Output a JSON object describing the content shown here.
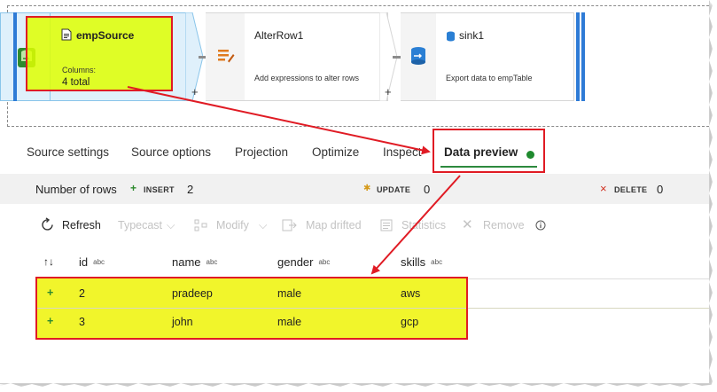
{
  "flow": {
    "source": {
      "title": "empSource",
      "columns_label": "Columns:",
      "columns_value": "4 total"
    },
    "alter": {
      "title": "AlterRow1",
      "description": "Add expressions to alter rows"
    },
    "sink": {
      "title": "sink1",
      "description": "Export data to empTable"
    },
    "plus": "+"
  },
  "tabs": [
    {
      "label": "Source settings"
    },
    {
      "label": "Source options"
    },
    {
      "label": "Projection"
    },
    {
      "label": "Optimize"
    },
    {
      "label": "Inspect"
    },
    {
      "label": "Data preview"
    }
  ],
  "rows_bar": {
    "number_label": "Number of rows",
    "insert_symbol": "+",
    "insert_label": "INSERT",
    "insert_count": "2",
    "update_symbol": "✱",
    "update_label": "UPDATE",
    "update_count": "0",
    "delete_symbol": "×",
    "delete_label": "DELETE",
    "delete_count": "0"
  },
  "toolbar": {
    "refresh": "Refresh",
    "typecast": "Typecast",
    "modify": "Modify",
    "map_drifted": "Map drifted",
    "statistics": "Statistics",
    "remove": "Remove"
  },
  "table": {
    "sort_icon": "↑↓",
    "type_tag": "abc",
    "columns": [
      "id",
      "name",
      "gender",
      "skills"
    ],
    "rows": [
      {
        "marker": "+",
        "id": "2",
        "name": "pradeep",
        "gender": "male",
        "skills": "aws"
      },
      {
        "marker": "+",
        "id": "3",
        "name": "john",
        "gender": "male",
        "skills": "gcp"
      }
    ]
  },
  "colors": {
    "highlight": "#e2ff00",
    "annotation_red": "#e01b24",
    "active_green": "#1f8a2e",
    "insert_green": "#2e8b2e",
    "delete_red": "#d03020",
    "update_amber": "#d59a1a"
  }
}
